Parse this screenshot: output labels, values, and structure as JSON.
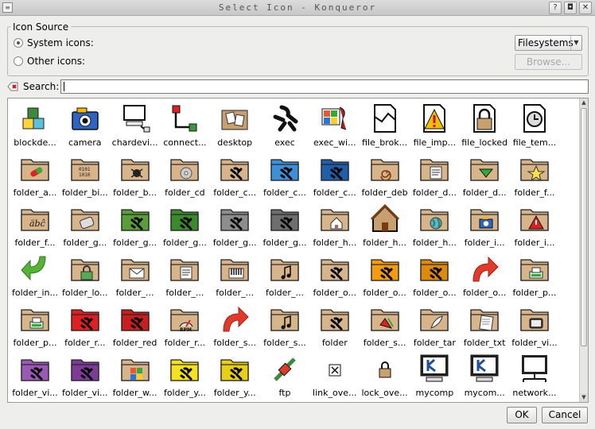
{
  "window": {
    "title": "Select Icon - Konqueror",
    "help_btn": "?",
    "min_btn": "◘",
    "close_btn": "✕"
  },
  "source": {
    "group_label": "Icon Source",
    "system_label": "System icons:",
    "other_label": "Other icons:",
    "selected": "system",
    "category": "Filesystems",
    "browse_label": "Browse..."
  },
  "search": {
    "label": "Search:",
    "value": ""
  },
  "icons": [
    {
      "label": "blockde...",
      "icon": "blocks"
    },
    {
      "label": "camera",
      "icon": "camera"
    },
    {
      "label": "chardevi...",
      "icon": "chardevice"
    },
    {
      "label": "connect...",
      "icon": "connect"
    },
    {
      "label": "desktop",
      "icon": "desktop"
    },
    {
      "label": "exec",
      "icon": "gear"
    },
    {
      "label": "exec_wi...",
      "icon": "exec-wine"
    },
    {
      "label": "file_brok...",
      "icon": "file-broken"
    },
    {
      "label": "file_imp...",
      "icon": "file-important"
    },
    {
      "label": "file_locked",
      "icon": "file-locked"
    },
    {
      "label": "file_tem...",
      "icon": "file-temporary"
    },
    {
      "label": "folder_a...",
      "icon": "folder",
      "emblem": "pill"
    },
    {
      "label": "folder_bi...",
      "icon": "folder",
      "emblem": "binary"
    },
    {
      "label": "folder_b...",
      "icon": "folder",
      "emblem": "bug"
    },
    {
      "label": "folder_cd",
      "icon": "folder",
      "emblem": "cd"
    },
    {
      "label": "folder_c...",
      "icon": "folder",
      "emblem": "gear"
    },
    {
      "label": "folder_c...",
      "icon": "folder",
      "emblem": "gear",
      "color": "#3d8fd6"
    },
    {
      "label": "folder_c...",
      "icon": "folder",
      "emblem": "gear",
      "color": "#1f5faa"
    },
    {
      "label": "folder_deb",
      "icon": "folder",
      "emblem": "swirl"
    },
    {
      "label": "folder_d...",
      "icon": "folder",
      "emblem": "doc"
    },
    {
      "label": "folder_d...",
      "icon": "folder",
      "emblem": "down"
    },
    {
      "label": "folder_f...",
      "icon": "folder",
      "emblem": "star"
    },
    {
      "label": "folder_f...",
      "icon": "folder",
      "emblem": "font"
    },
    {
      "label": "folder_g...",
      "icon": "folder",
      "emblem": "games"
    },
    {
      "label": "folder_g...",
      "icon": "folder",
      "emblem": "gear",
      "color": "#5a9e3a"
    },
    {
      "label": "folder_g...",
      "icon": "folder",
      "emblem": "gear",
      "color": "#3c8a2e"
    },
    {
      "label": "folder_g...",
      "icon": "folder",
      "emblem": "gear",
      "color": "#8d8d8d"
    },
    {
      "label": "folder_g...",
      "icon": "folder",
      "emblem": "gear",
      "color": "#6e6e6e"
    },
    {
      "label": "folder_h...",
      "icon": "folder",
      "emblem": "house"
    },
    {
      "label": "folder_h...",
      "icon": "house"
    },
    {
      "label": "folder_h...",
      "icon": "folder",
      "emblem": "globe"
    },
    {
      "label": "folder_i...",
      "icon": "folder",
      "emblem": "camera"
    },
    {
      "label": "folder_i...",
      "icon": "folder",
      "emblem": "warn"
    },
    {
      "label": "folder_in...",
      "icon": "arrow-green"
    },
    {
      "label": "folder_lo...",
      "icon": "folder",
      "emblem": "lock"
    },
    {
      "label": "folder_...",
      "icon": "folder",
      "emblem": "mail"
    },
    {
      "label": "folder_...",
      "icon": "folder",
      "emblem": "doc"
    },
    {
      "label": "folder_...",
      "icon": "folder",
      "emblem": "piano"
    },
    {
      "label": "folder_...",
      "icon": "folder",
      "emblem": "note"
    },
    {
      "label": "folder_o...",
      "icon": "folder",
      "emblem": "gear"
    },
    {
      "label": "folder_o...",
      "icon": "folder",
      "emblem": "gear",
      "color": "#f39c12"
    },
    {
      "label": "folder_o...",
      "icon": "folder",
      "emblem": "gear",
      "color": "#e08a0c"
    },
    {
      "label": "folder_o...",
      "icon": "arrow-red"
    },
    {
      "label": "folder_p...",
      "icon": "folder",
      "emblem": "print"
    },
    {
      "label": "folder_p...",
      "icon": "folder",
      "emblem": "print"
    },
    {
      "label": "folder_r...",
      "icon": "folder",
      "emblem": "gear",
      "color": "#e02020"
    },
    {
      "label": "folder_red",
      "icon": "folder",
      "emblem": "gear",
      "color": "#c81e1e"
    },
    {
      "label": "folder_r...",
      "icon": "folder",
      "emblem": "rpm"
    },
    {
      "label": "folder_s...",
      "icon": "arrow-red"
    },
    {
      "label": "folder_s...",
      "icon": "folder",
      "emblem": "note"
    },
    {
      "label": "folder",
      "icon": "folder",
      "emblem": "gear"
    },
    {
      "label": "folder_s...",
      "icon": "folder",
      "emblem": "sound"
    },
    {
      "label": "folder_tar",
      "icon": "folder",
      "emblem": "feather"
    },
    {
      "label": "folder_txt",
      "icon": "folder",
      "emblem": "page"
    },
    {
      "label": "folder_vi...",
      "icon": "folder",
      "emblem": "tv"
    },
    {
      "label": "folder_vi...",
      "icon": "folder",
      "emblem": "gear",
      "color": "#9b59b6"
    },
    {
      "label": "folder_vi...",
      "icon": "folder",
      "emblem": "gear",
      "color": "#7d3c98"
    },
    {
      "label": "folder_w...",
      "icon": "folder",
      "emblem": "windows"
    },
    {
      "label": "folder_y...",
      "icon": "folder",
      "emblem": "gear",
      "color": "#f4e21c"
    },
    {
      "label": "folder_y...",
      "icon": "folder",
      "emblem": "gear",
      "color": "#e8cf16"
    },
    {
      "label": "ftp",
      "icon": "ftp"
    },
    {
      "label": "link_ove...",
      "icon": "link-small"
    },
    {
      "label": "lock_ove...",
      "icon": "lock-small"
    },
    {
      "label": "mycomp",
      "icon": "monitor-k"
    },
    {
      "label": "mycom...",
      "icon": "monitor-k"
    },
    {
      "label": "network...",
      "icon": "monitor-net"
    }
  ],
  "buttons": {
    "ok": "OK",
    "cancel": "Cancel"
  }
}
